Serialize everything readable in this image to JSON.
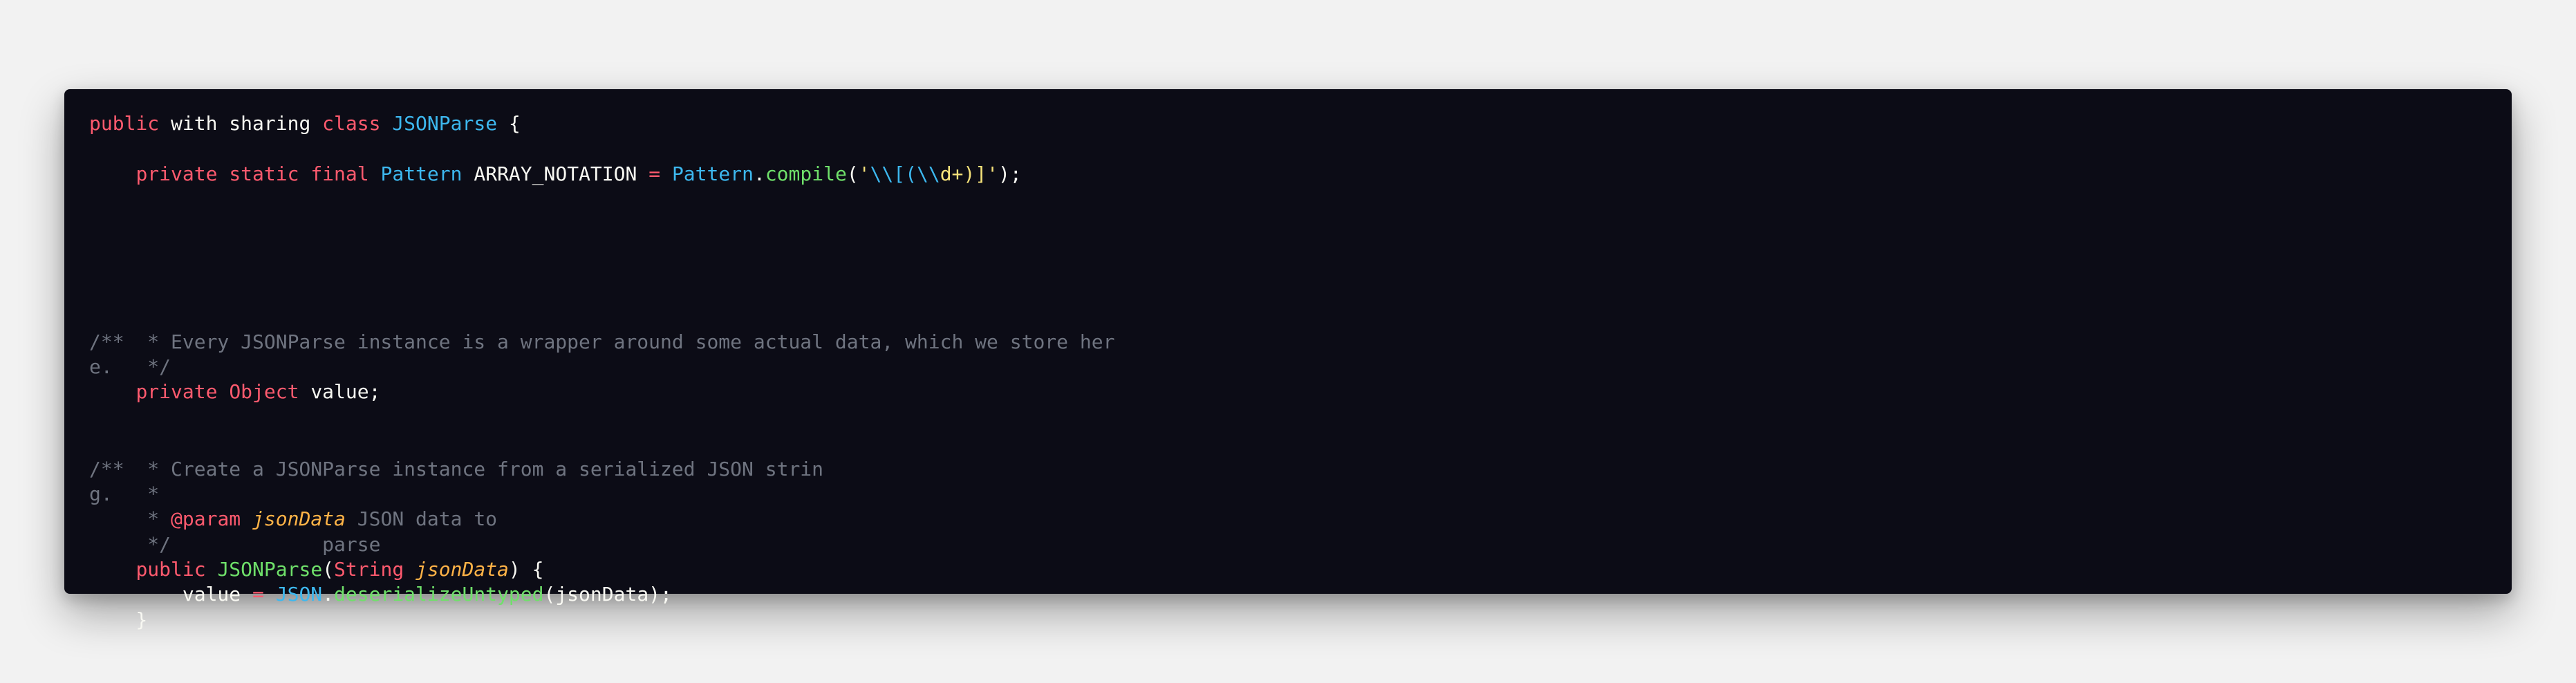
{
  "editor": {
    "theme_colors": {
      "background": "#0c0c16",
      "keyword": "#ff5a6e",
      "type": "#3db8ef",
      "function": "#6fe06a",
      "string": "#f6e27a",
      "comment": "#6f7480",
      "param": "#ffb347",
      "text": "#f8f8f2"
    },
    "lines": {
      "l1": {
        "kw_public": "public",
        "with_sharing": " with sharing ",
        "kw_class": "class",
        "class_name": "JSONParse",
        "open_brace": " {"
      },
      "l2": {
        "indent": "    ",
        "kw_private": "private",
        "kw_static": "static",
        "kw_final": "final",
        "type_pattern": "Pattern",
        "const_name": " ARRAY_NOTATION ",
        "op_assign": "=",
        "type_pattern2": "Pattern",
        "dot": ".",
        "fn_compile": "compile",
        "paren_open": "(",
        "str_q1": "'",
        "str_esc1": "\\\\[(\\\\",
        "str_mid": "d+",
        "str_end": ")]'",
        "close": ");"
      },
      "l3": {
        "comment": "/**  * Every JSONParse instance is a wrapper around some actual data, which we store her"
      },
      "l4": {
        "comment": "e.   */"
      },
      "l5": {
        "indent": "    ",
        "kw_private": "private",
        "type_object": "Object",
        "rest": " value;"
      },
      "l6": {
        "comment": "/**  * Create a JSONParse instance from a serialized JSON strin"
      },
      "l7": {
        "comment": "g.   *"
      },
      "l8": {
        "prefix": "     * ",
        "tag_param": "@param",
        "param_name": "jsonData",
        "desc": " JSON data to"
      },
      "l9": {
        "comment": "     */             parse"
      },
      "l10": {
        "indent": "    ",
        "kw_public": "public",
        "fn_ctor": "JSONParse",
        "paren_open": "(",
        "type_string": "String",
        "param_name": "jsonData",
        "close": ") {"
      },
      "l11": {
        "indent": "        ",
        "var_value": "value ",
        "op_assign": "=",
        "type_json": "JSON",
        "dot": ".",
        "fn_deserialize": "deserializeUntyped",
        "args": "(jsonData);"
      },
      "l12": {
        "text": "    }"
      }
    }
  }
}
